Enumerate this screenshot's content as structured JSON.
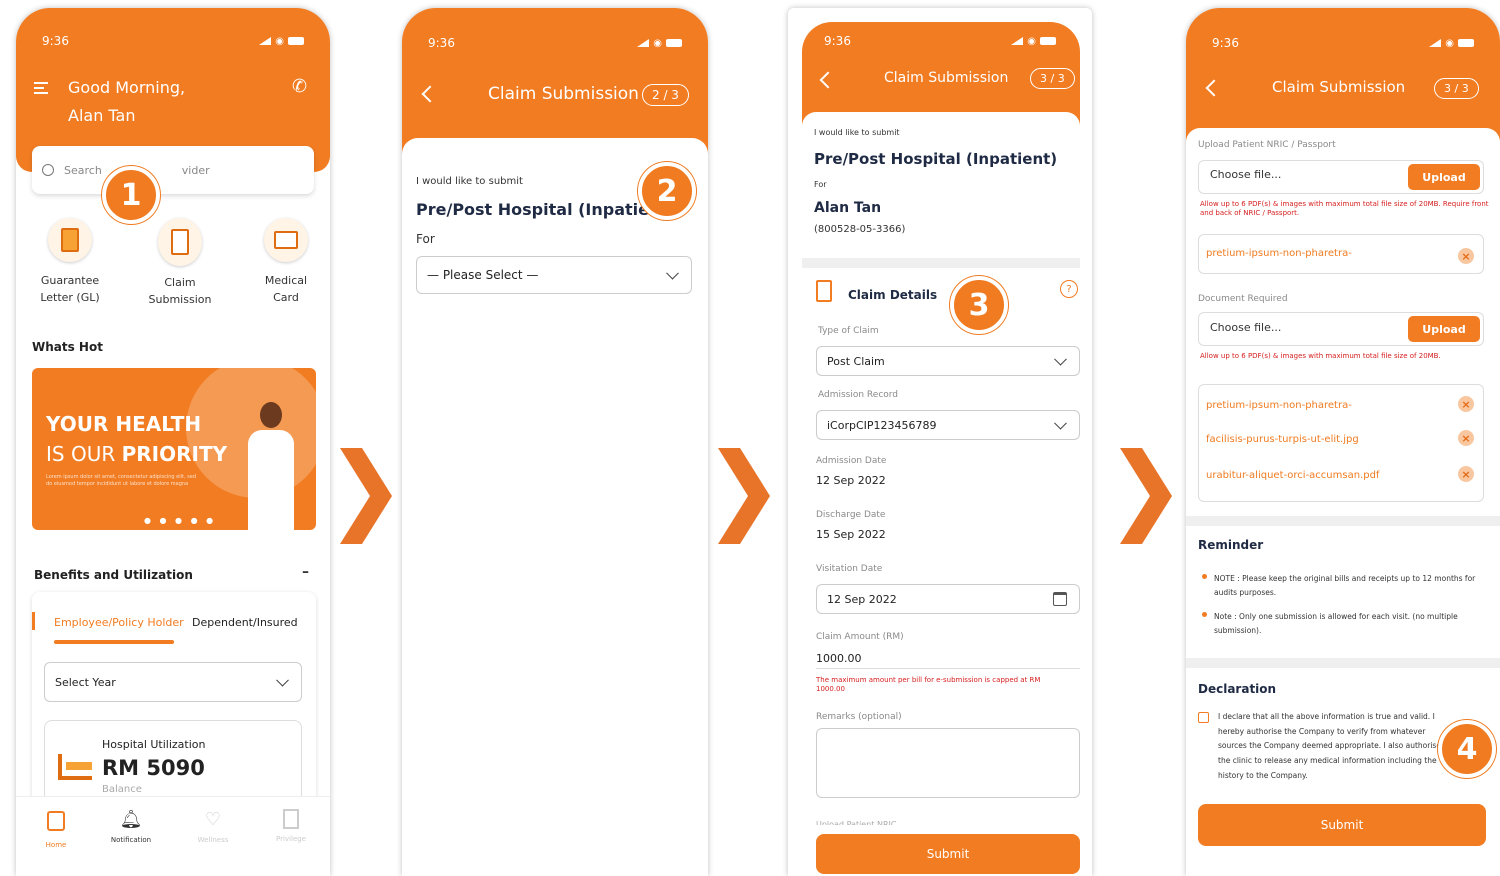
{
  "colors": {
    "accent": "#f17c22",
    "badge": "#f07b20",
    "error": "#d62020"
  },
  "badges": [
    "1",
    "2",
    "3",
    "4"
  ],
  "screen1": {
    "time": "9:36",
    "greeting": "Good Morning,",
    "user": "Alan Tan",
    "search_start": "Search",
    "search_end": "vider",
    "quick": [
      {
        "line1": "Guarantee",
        "line2": "Letter (GL)",
        "icon": "document-stack-icon"
      },
      {
        "line1": "Claim",
        "line2": "Submission",
        "icon": "clipboard-icon"
      },
      {
        "line1": "Medical",
        "line2": "Card",
        "icon": "id-card-icon"
      }
    ],
    "whats_hot": "Whats Hot",
    "banner_line1": "YOUR HEALTH",
    "banner_line2a": "IS OUR ",
    "banner_line2b": "PRIORITY",
    "banner_small": "Lorem ipsum dolor sit amet, consectetur adipiscing elit, sed do eiusmod tempor incididunt ut labore et dolore magna",
    "benefits_title": "Benefits and Utilization",
    "benefits_toggle": "–",
    "tab_active": "Employee/Policy Holder",
    "tab_other": "Dependent/Insured",
    "select_year": "Select Year",
    "hosp_label": "Hospital Utilization",
    "hosp_amount": "RM 5090",
    "hosp_sub": "Balance",
    "nav": [
      "Home",
      "Notification",
      "Wellness",
      "Privilege"
    ]
  },
  "screen2": {
    "time": "9:36",
    "title": "Claim Submission",
    "step": "2 / 3",
    "submit_intro": "I would like to submit",
    "claim_type": "Pre/Post Hospital (Inpatient)",
    "for_label": "For",
    "select_placeholder": "— Please Select —"
  },
  "screen3": {
    "time": "9:36",
    "title": "Claim Submission",
    "step": "3 / 3",
    "submit_intro": "I would like to submit",
    "claim_type": "Pre/Post Hospital (Inpatient)",
    "for_label": "For",
    "name": "Alan Tan",
    "ic": "(800528-05-3366)",
    "details_title": "Claim Details",
    "type_label": "Type of Claim",
    "type_value": "Post Claim",
    "adm_rec_label": "Admission Record",
    "adm_rec_value": "iCorpCIP123456789",
    "adm_date_label": "Admission Date",
    "adm_date_value": "12 Sep 2022",
    "dis_date_label": "Discharge Date",
    "dis_date_value": "15 Sep 2022",
    "visit_label": "Visitation Date",
    "visit_value": "12 Sep 2022",
    "amount_label": "Claim Amount (RM)",
    "amount_value": "1000.00",
    "amount_error": "The maximum amount per bill for e-submission is capped at RM 1000.00",
    "remarks_label": "Remarks (optional)",
    "upload_hint": "Upload Patient NRIC",
    "submit": "Submit"
  },
  "screen4": {
    "time": "9:36",
    "title": "Claim Submission",
    "step": "3 / 3",
    "upload_label": "Upload Patient NRIC / Passport",
    "choose": "Choose file...",
    "upload_btn": "Upload",
    "upload_error": "Allow up to 6 PDF(s) & images with maximum total file size of 20MB. Require front and back of NRIC / Passport.",
    "nric_file": "pretium-ipsum-non-pharetra-",
    "doc_label": "Document Required",
    "choose2": "Choose file...",
    "upload_btn2": "Upload",
    "doc_error": "Allow up to 6 PDF(s) & images with maximum total file size of 20MB.",
    "doc_files": [
      "pretium-ipsum-non-pharetra-",
      "facilisis-purus-turpis-ut-elit.jpg",
      "urabitur-aliquet-orci-accumsan.pdf"
    ],
    "reminder_title": "Reminder",
    "reminder1": "NOTE : Please keep the original bills and receipts up to 12 months for audits purposes.",
    "reminder2": "Note : Only one submission is allowed for each visit. (no multiple submission).",
    "declaration_title": "Declaration",
    "declaration_text": "I declare that all the above information is true and valid. I hereby authorise the Company to verify from whatever sources the Company deemed appropriate. I also authorise the clinic to release any medical information including the history to the Company.",
    "submit": "Submit"
  }
}
